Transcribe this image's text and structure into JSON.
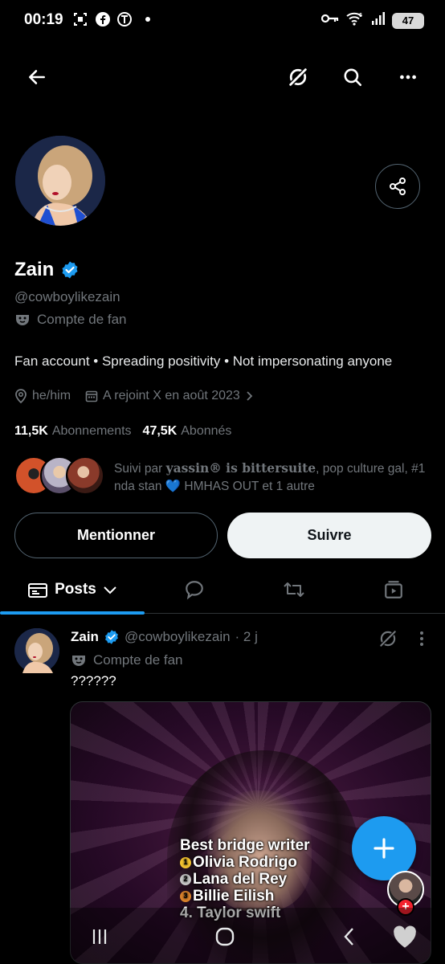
{
  "status_bar": {
    "time": "00:19",
    "battery": "47",
    "icons_left": [
      "screenshot-icon",
      "facebook-icon",
      "app-icon",
      "dot-icon"
    ],
    "icons_right": [
      "key-icon",
      "wifi-6-icon",
      "signal-icon",
      "battery-icon"
    ]
  },
  "top_nav": {
    "back_icon": "arrow-left-icon",
    "grok_icon": "grok-icon",
    "search_icon": "search-icon",
    "more_icon": "more-horizontal-icon"
  },
  "profile": {
    "display_name": "Zain",
    "verified": true,
    "handle": "@cowboylikezain",
    "label": "Compte de fan",
    "bio": "Fan account • Spreading positivity • Not impersonating anyone",
    "pronouns": "he/him",
    "joined": "A rejoint X en août 2023",
    "following_count": "11,5K",
    "following_label": "Abonnements",
    "followers_count": "47,5K",
    "followers_label": "Abonnés",
    "followed_by_prefix": "Suivi par ",
    "followed_by_name1": "yassin® is bittersuite",
    "followed_by_rest": ", pop culture gal, #1 nda stan 💙 HMHAS OUT et 1 autre"
  },
  "actions": {
    "mention_label": "Mentionner",
    "follow_label": "Suivre"
  },
  "tabs": {
    "active_label": "Posts",
    "others": [
      "replies-icon",
      "reposts-icon",
      "media-icon"
    ]
  },
  "post": {
    "name": "Zain",
    "handle": "@cowboylikezain",
    "time": "· 2 j",
    "label": "Compte de fan",
    "text": "??????",
    "media_caption": {
      "title": "Best bridge writer",
      "items": [
        {
          "rank": "1",
          "name": "Olivia Rodrigo",
          "color": "#f2c230"
        },
        {
          "rank": "2",
          "name": "Lana del Rey",
          "color": "#c7c7c7"
        },
        {
          "rank": "3",
          "name": "Billie Eilish",
          "color": "#d9822b"
        }
      ],
      "fourth": "4. Taylor swift"
    }
  },
  "colors": {
    "accent": "#1d9bf0",
    "muted": "#71767b",
    "border": "#2f3336"
  }
}
